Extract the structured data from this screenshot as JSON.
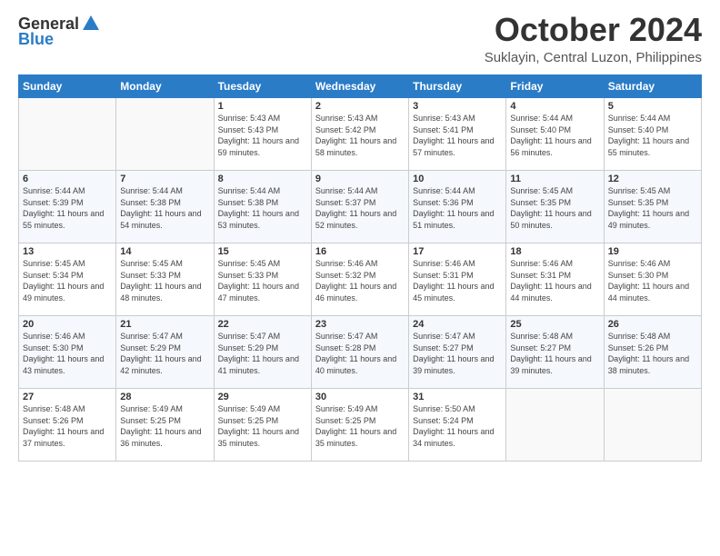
{
  "logo": {
    "line1": "General",
    "line2": "Blue"
  },
  "title": "October 2024",
  "location": "Suklayin, Central Luzon, Philippines",
  "headers": [
    "Sunday",
    "Monday",
    "Tuesday",
    "Wednesday",
    "Thursday",
    "Friday",
    "Saturday"
  ],
  "weeks": [
    [
      {
        "day": "",
        "info": ""
      },
      {
        "day": "",
        "info": ""
      },
      {
        "day": "1",
        "info": "Sunrise: 5:43 AM\nSunset: 5:43 PM\nDaylight: 11 hours and 59 minutes."
      },
      {
        "day": "2",
        "info": "Sunrise: 5:43 AM\nSunset: 5:42 PM\nDaylight: 11 hours and 58 minutes."
      },
      {
        "day": "3",
        "info": "Sunrise: 5:43 AM\nSunset: 5:41 PM\nDaylight: 11 hours and 57 minutes."
      },
      {
        "day": "4",
        "info": "Sunrise: 5:44 AM\nSunset: 5:40 PM\nDaylight: 11 hours and 56 minutes."
      },
      {
        "day": "5",
        "info": "Sunrise: 5:44 AM\nSunset: 5:40 PM\nDaylight: 11 hours and 55 minutes."
      }
    ],
    [
      {
        "day": "6",
        "info": "Sunrise: 5:44 AM\nSunset: 5:39 PM\nDaylight: 11 hours and 55 minutes."
      },
      {
        "day": "7",
        "info": "Sunrise: 5:44 AM\nSunset: 5:38 PM\nDaylight: 11 hours and 54 minutes."
      },
      {
        "day": "8",
        "info": "Sunrise: 5:44 AM\nSunset: 5:38 PM\nDaylight: 11 hours and 53 minutes."
      },
      {
        "day": "9",
        "info": "Sunrise: 5:44 AM\nSunset: 5:37 PM\nDaylight: 11 hours and 52 minutes."
      },
      {
        "day": "10",
        "info": "Sunrise: 5:44 AM\nSunset: 5:36 PM\nDaylight: 11 hours and 51 minutes."
      },
      {
        "day": "11",
        "info": "Sunrise: 5:45 AM\nSunset: 5:35 PM\nDaylight: 11 hours and 50 minutes."
      },
      {
        "day": "12",
        "info": "Sunrise: 5:45 AM\nSunset: 5:35 PM\nDaylight: 11 hours and 49 minutes."
      }
    ],
    [
      {
        "day": "13",
        "info": "Sunrise: 5:45 AM\nSunset: 5:34 PM\nDaylight: 11 hours and 49 minutes."
      },
      {
        "day": "14",
        "info": "Sunrise: 5:45 AM\nSunset: 5:33 PM\nDaylight: 11 hours and 48 minutes."
      },
      {
        "day": "15",
        "info": "Sunrise: 5:45 AM\nSunset: 5:33 PM\nDaylight: 11 hours and 47 minutes."
      },
      {
        "day": "16",
        "info": "Sunrise: 5:46 AM\nSunset: 5:32 PM\nDaylight: 11 hours and 46 minutes."
      },
      {
        "day": "17",
        "info": "Sunrise: 5:46 AM\nSunset: 5:31 PM\nDaylight: 11 hours and 45 minutes."
      },
      {
        "day": "18",
        "info": "Sunrise: 5:46 AM\nSunset: 5:31 PM\nDaylight: 11 hours and 44 minutes."
      },
      {
        "day": "19",
        "info": "Sunrise: 5:46 AM\nSunset: 5:30 PM\nDaylight: 11 hours and 44 minutes."
      }
    ],
    [
      {
        "day": "20",
        "info": "Sunrise: 5:46 AM\nSunset: 5:30 PM\nDaylight: 11 hours and 43 minutes."
      },
      {
        "day": "21",
        "info": "Sunrise: 5:47 AM\nSunset: 5:29 PM\nDaylight: 11 hours and 42 minutes."
      },
      {
        "day": "22",
        "info": "Sunrise: 5:47 AM\nSunset: 5:29 PM\nDaylight: 11 hours and 41 minutes."
      },
      {
        "day": "23",
        "info": "Sunrise: 5:47 AM\nSunset: 5:28 PM\nDaylight: 11 hours and 40 minutes."
      },
      {
        "day": "24",
        "info": "Sunrise: 5:47 AM\nSunset: 5:27 PM\nDaylight: 11 hours and 39 minutes."
      },
      {
        "day": "25",
        "info": "Sunrise: 5:48 AM\nSunset: 5:27 PM\nDaylight: 11 hours and 39 minutes."
      },
      {
        "day": "26",
        "info": "Sunrise: 5:48 AM\nSunset: 5:26 PM\nDaylight: 11 hours and 38 minutes."
      }
    ],
    [
      {
        "day": "27",
        "info": "Sunrise: 5:48 AM\nSunset: 5:26 PM\nDaylight: 11 hours and 37 minutes."
      },
      {
        "day": "28",
        "info": "Sunrise: 5:49 AM\nSunset: 5:25 PM\nDaylight: 11 hours and 36 minutes."
      },
      {
        "day": "29",
        "info": "Sunrise: 5:49 AM\nSunset: 5:25 PM\nDaylight: 11 hours and 35 minutes."
      },
      {
        "day": "30",
        "info": "Sunrise: 5:49 AM\nSunset: 5:25 PM\nDaylight: 11 hours and 35 minutes."
      },
      {
        "day": "31",
        "info": "Sunrise: 5:50 AM\nSunset: 5:24 PM\nDaylight: 11 hours and 34 minutes."
      },
      {
        "day": "",
        "info": ""
      },
      {
        "day": "",
        "info": ""
      }
    ]
  ]
}
